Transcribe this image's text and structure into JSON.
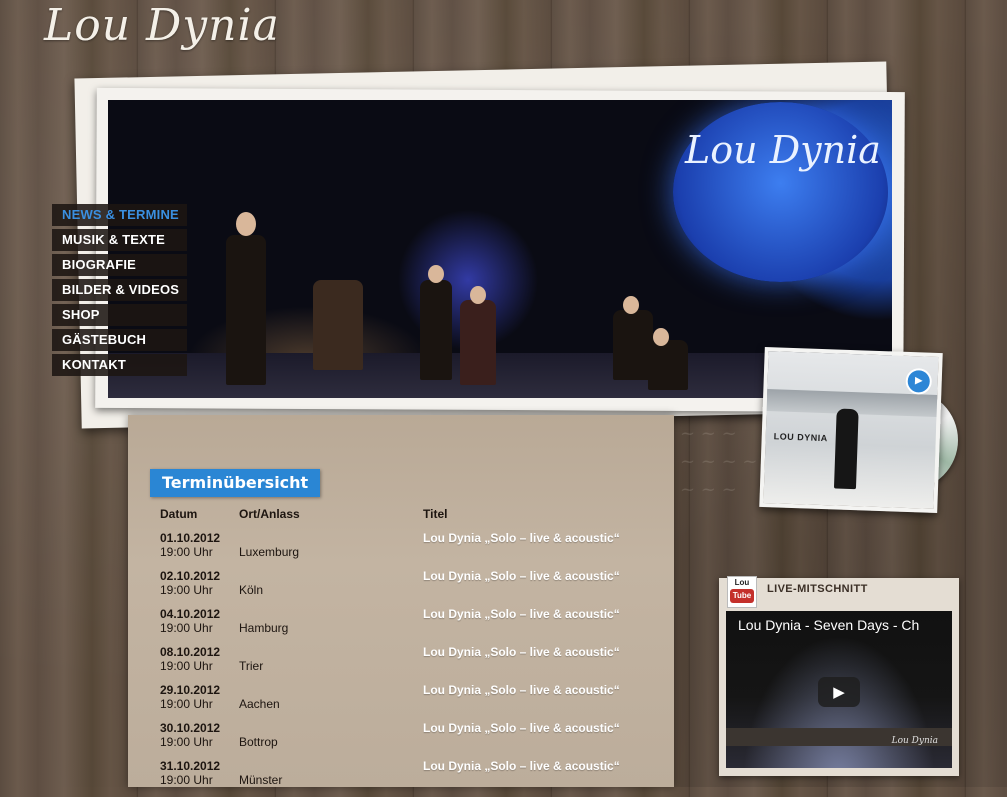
{
  "site": {
    "logo_text": "Lou Dynia"
  },
  "hero": {
    "stage_sign_text": "Lou Dynia"
  },
  "nav": {
    "items": [
      {
        "label": "NEWS & TERMINE",
        "active": true
      },
      {
        "label": "MUSIK & TEXTE",
        "active": false
      },
      {
        "label": "BIOGRAFIE",
        "active": false
      },
      {
        "label": "BILDER & VIDEOS",
        "active": false
      },
      {
        "label": "SHOP",
        "active": false
      },
      {
        "label": "GÄSTEBUCH",
        "active": false
      },
      {
        "label": "KONTAKT",
        "active": false
      }
    ]
  },
  "cd": {
    "title": "LOU DYNIA",
    "play_icon": "play-circle-icon"
  },
  "events": {
    "heading": "Terminübersicht",
    "columns": {
      "date": "Datum",
      "place": "Ort/Anlass",
      "title": "Titel"
    },
    "rows": [
      {
        "date": "01.10.2012",
        "time": "19:00 Uhr",
        "place": "Luxemburg",
        "title": "Lou Dynia „Solo – live & acoustic“"
      },
      {
        "date": "02.10.2012",
        "time": "19:00 Uhr",
        "place": "Köln",
        "title": "Lou Dynia „Solo – live & acoustic“"
      },
      {
        "date": "04.10.2012",
        "time": "19:00 Uhr",
        "place": "Hamburg",
        "title": "Lou Dynia „Solo – live & acoustic“"
      },
      {
        "date": "08.10.2012",
        "time": "19:00 Uhr",
        "place": "Trier",
        "title": "Lou Dynia „Solo – live & acoustic“"
      },
      {
        "date": "29.10.2012",
        "time": "19:00 Uhr",
        "place": "Aachen",
        "title": "Lou Dynia „Solo – live & acoustic“"
      },
      {
        "date": "30.10.2012",
        "time": "19:00 Uhr",
        "place": "Bottrop",
        "title": "Lou Dynia „Solo – live & acoustic“"
      },
      {
        "date": "31.10.2012",
        "time": "19:00 Uhr",
        "place": "Münster",
        "title": "Lou Dynia „Solo – live & acoustic“"
      }
    ]
  },
  "youtube": {
    "icon_top": "Lou",
    "icon_bottom": "Tube",
    "label": "LIVE-MITSCHNITT",
    "video_title": "Lou Dynia - Seven Days - Ch",
    "signature": "Lou Dynia",
    "play_icon": "play-button-icon"
  },
  "colors": {
    "accent_blue": "#2a86d4",
    "nav_active": "#3a8fe0",
    "youtube_red": "#c4302b"
  }
}
